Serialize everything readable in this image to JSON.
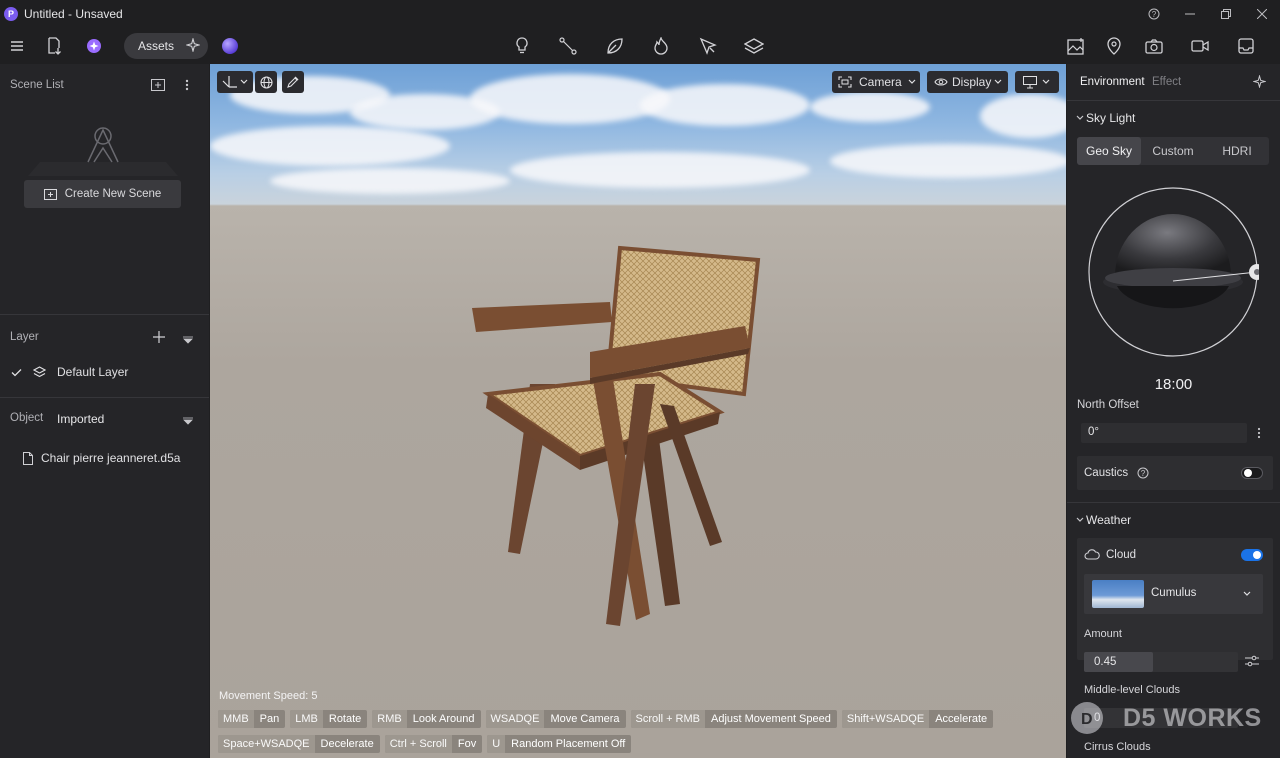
{
  "window": {
    "logo_letter": "P",
    "title": "Untitled - Unsaved",
    "controls": [
      "help-icon",
      "minimize-icon",
      "restore-icon",
      "close-icon"
    ]
  },
  "toolbar": {
    "assets_label": "Assets",
    "left_icons": [
      "menu-icon",
      "import-file-icon",
      "ai-assistant-icon"
    ],
    "center_icons": [
      "light-icon",
      "path-icon",
      "vegetation-icon",
      "fire-effect-icon",
      "select-tool-icon",
      "material-layer-icon"
    ],
    "right_icons": [
      "image-render-icon",
      "map-pin-icon",
      "camera-icon",
      "video-icon",
      "inbox-icon"
    ]
  },
  "left_panel": {
    "scene_list_title": "Scene List",
    "create_scene_label": "Create New Scene",
    "layer_title": "Layer",
    "default_layer": "Default Layer",
    "object_title": "Object",
    "object_filter": "Imported",
    "object_file": "Chair pierre jeanneret.d5a"
  },
  "viewport": {
    "camera_label": "Camera",
    "display_label": "Display",
    "movement_speed": "Movement Speed: 5",
    "hints_row1": [
      {
        "key": "MMB",
        "action": "Pan"
      },
      {
        "key": "LMB",
        "action": "Rotate"
      },
      {
        "key": "RMB",
        "action": "Look Around"
      },
      {
        "key": "WSADQE",
        "action": "Move Camera"
      },
      {
        "key": "Scroll + RMB",
        "action": "Adjust Movement Speed"
      },
      {
        "key": "Shift+WSADQE",
        "action": "Accelerate"
      }
    ],
    "hints_row2": [
      {
        "key": "Space+WSADQE",
        "action": "Decelerate"
      },
      {
        "key": "Ctrl + Scroll",
        "action": "Fov"
      },
      {
        "key": "U",
        "action": "Random Placement Off"
      }
    ]
  },
  "right_panel": {
    "tab_environment": "Environment",
    "tab_effect": "Effect",
    "sky_light_title": "Sky Light",
    "sky_modes": [
      "Geo Sky",
      "Custom",
      "HDRI"
    ],
    "sky_mode_active": "Geo Sky",
    "time": "18:00",
    "north_offset_label": "North Offset",
    "north_offset_value": "0°",
    "caustics_label": "Caustics",
    "caustics_on": false,
    "weather_title": "Weather",
    "cloud_label": "Cloud",
    "cloud_on": true,
    "cloud_type": "Cumulus",
    "amount_label": "Amount",
    "amount_value": "0.45",
    "amount_fill": 0.45,
    "middle_clouds_label": "Middle-level Clouds",
    "middle_clouds_value": "0",
    "cirrus_label": "Cirrus Clouds",
    "accent": "#1a73e8"
  },
  "watermark": "D5 WORKS"
}
